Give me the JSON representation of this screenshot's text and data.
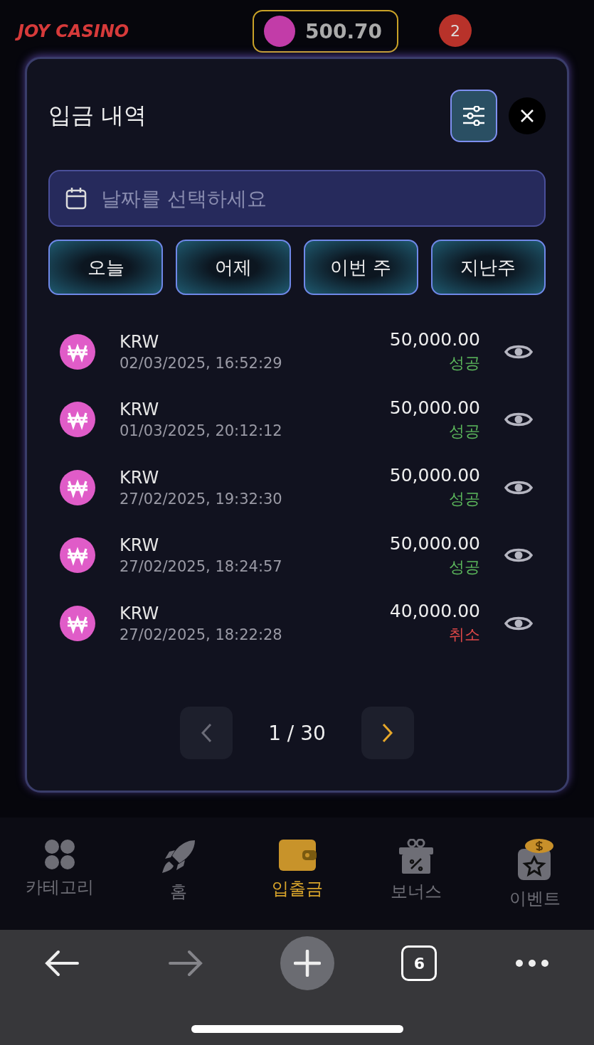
{
  "header": {
    "logo": "JOY CASINO",
    "balance": "500.70",
    "notification_count": "2"
  },
  "modal": {
    "title": "입금 내역",
    "date_field": {
      "placeholder": "날짜를 선택하세요"
    },
    "quick_ranges": [
      {
        "label": "오늘"
      },
      {
        "label": "어제"
      },
      {
        "label": "이번 주"
      },
      {
        "label": "지난주"
      }
    ],
    "transactions": [
      {
        "currency": "KRW",
        "datetime": "02/03/2025, 16:52:29",
        "amount": "50,000.00",
        "status": "성공",
        "kind": "success"
      },
      {
        "currency": "KRW",
        "datetime": "01/03/2025, 20:12:12",
        "amount": "50,000.00",
        "status": "성공",
        "kind": "success"
      },
      {
        "currency": "KRW",
        "datetime": "27/02/2025, 19:32:30",
        "amount": "50,000.00",
        "status": "성공",
        "kind": "success"
      },
      {
        "currency": "KRW",
        "datetime": "27/02/2025, 18:24:57",
        "amount": "50,000.00",
        "status": "성공",
        "kind": "success"
      },
      {
        "currency": "KRW",
        "datetime": "27/02/2025, 18:22:28",
        "amount": "40,000.00",
        "status": "취소",
        "kind": "cancelled"
      }
    ],
    "pagination": {
      "page": "1 / 30",
      "prev": {
        "disabled": true
      },
      "next": {
        "disabled": false
      }
    }
  },
  "bottom_nav": [
    {
      "label": "카테고리",
      "selected": false
    },
    {
      "label": "홈",
      "selected": false
    },
    {
      "label": "입출금",
      "selected": true
    },
    {
      "label": "보너스",
      "selected": false
    },
    {
      "label": "이벤트",
      "selected": false
    }
  ],
  "browser_toolbar": {
    "tab_count": "6"
  }
}
